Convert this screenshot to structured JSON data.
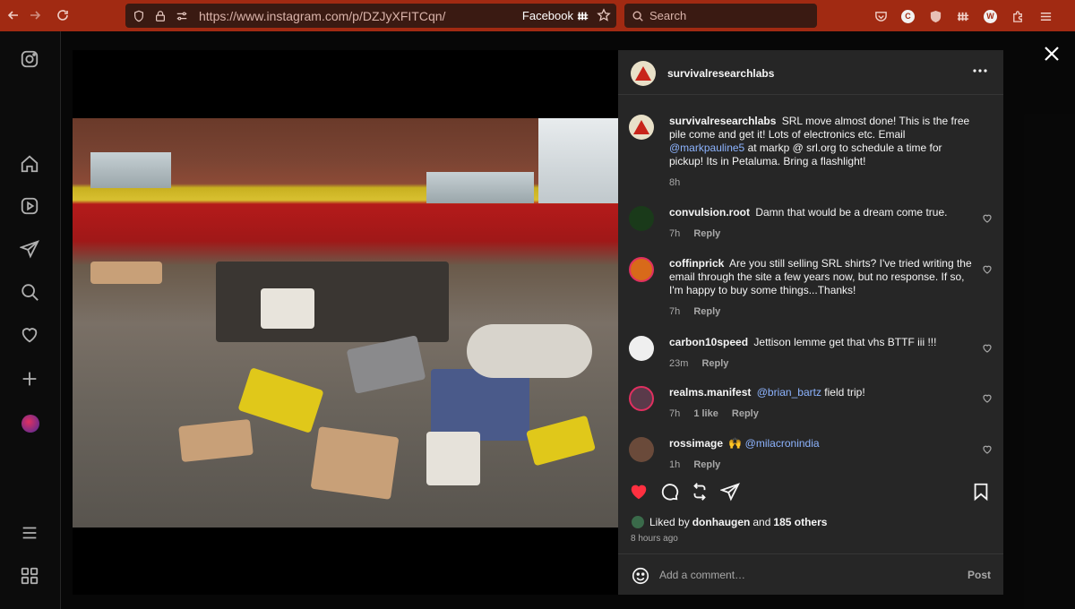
{
  "browser": {
    "url": "https://www.instagram.com/p/DZJyXFITCqn/",
    "site_badge": "Facebook",
    "search_placeholder": "Search"
  },
  "post": {
    "author": "survivalresearchlabs",
    "caption": {
      "author": "survivalresearchlabs",
      "text_before": "SRL move almost done! This is the free pile come and get it! Lots of electronics etc. Email",
      "mention": "@markpauline5",
      "text_after": "at markp @ srl.org to schedule a time for pickup! Its in Petaluma. Bring a flashlight!",
      "time": "8h"
    },
    "comments": [
      {
        "user": "convulsion.root",
        "text": "Damn that would be a dream come true.",
        "time": "7h",
        "reply": "Reply"
      },
      {
        "user": "coffinprick",
        "text": "Are you still selling SRL shirts? I've tried writing the email through the site a few years now, but no response. If so, I'm happy to buy some things...Thanks!",
        "time": "7h",
        "reply": "Reply"
      },
      {
        "user": "carbon10speed",
        "text": "Jettison lemme get that vhs BTTF iii !!!",
        "time": "23m",
        "reply": "Reply"
      },
      {
        "user": "realms.manifest",
        "mention": "@brian_bartz",
        "text": "field trip!",
        "time": "7h",
        "likes": "1 like",
        "reply": "Reply"
      },
      {
        "user": "rossimage",
        "prefix": "🙌",
        "mention": "@milacronindia",
        "time": "1h",
        "reply": "Reply"
      }
    ],
    "liked_by_prefix": "Liked by",
    "liked_by_user": "donhaugen",
    "liked_by_and": "and",
    "liked_by_others": "185 others",
    "posted_ago": "8 hours ago",
    "comment_placeholder": "Add a comment…",
    "post_label": "Post"
  }
}
